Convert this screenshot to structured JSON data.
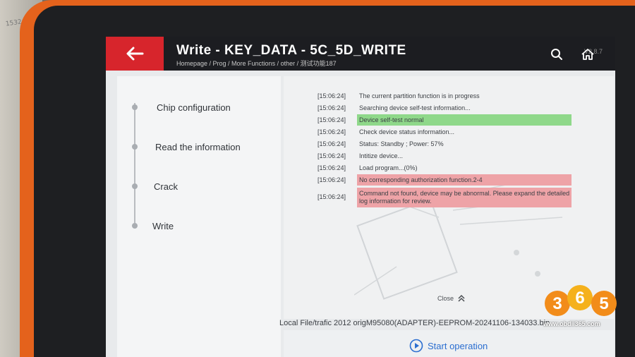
{
  "header": {
    "title": "Write - KEY_DATA - 5C_5D_WRITE",
    "breadcrumb": "Homepage / Prog / More Functions / other / 测试功能187",
    "version": "V2.8.7"
  },
  "steps": [
    {
      "label": "Chip configuration"
    },
    {
      "label": "Read the information"
    },
    {
      "label": "Crack"
    },
    {
      "label": "Write"
    }
  ],
  "log": [
    {
      "time": "[15:06:24]",
      "msg": "The current partition function is in progress",
      "status": "normal"
    },
    {
      "time": "[15:06:24]",
      "msg": "Searching device self-test information...",
      "status": "normal"
    },
    {
      "time": "[15:06:24]",
      "msg": "Device self-test normal",
      "status": "ok"
    },
    {
      "time": "[15:06:24]",
      "msg": "Check device status information...",
      "status": "normal"
    },
    {
      "time": "[15:06:24]",
      "msg": "Status: Standby ; Power: 57%",
      "status": "normal"
    },
    {
      "time": "[15:06:24]",
      "msg": "Intitize device...",
      "status": "normal"
    },
    {
      "time": "[15:06:24]",
      "msg": "Load program...(0%)",
      "status": "normal"
    },
    {
      "time": "[15:06:24]",
      "msg": "No corresponding authorization function.2-4",
      "status": "error"
    },
    {
      "time": "[15:06:24]",
      "msg": "Command not found, device may be abnormal. Please expand the detailed log information for review.",
      "status": "error"
    }
  ],
  "close_label": "Close",
  "file_path": "Local File/trafic 2012 origM95080(ADAPTER)-EEPROM-20241106-134033.bin",
  "start_label": "Start operation",
  "watermark": {
    "digits": [
      "3",
      "6",
      "5"
    ],
    "url": "www.obdii365.com"
  },
  "desk_text": "1532",
  "colors": {
    "accent_red": "#d7252c",
    "ok_green": "#8fd88a",
    "error_red": "#eea3a7",
    "link_blue": "#2b6ed0",
    "tablet_orange": "#e4621c"
  }
}
